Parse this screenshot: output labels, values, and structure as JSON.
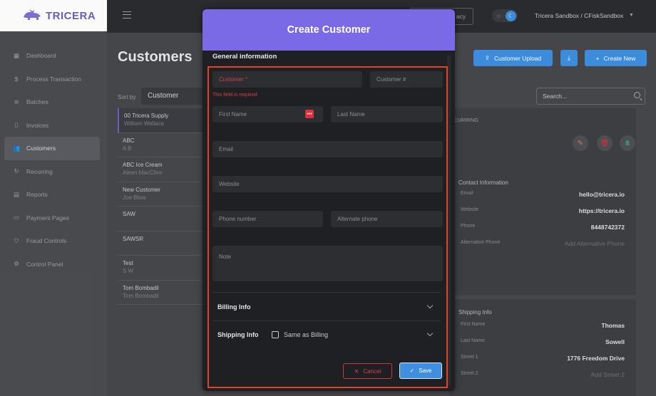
{
  "brand": {
    "logo_text": "TRICERA"
  },
  "sidebar": {
    "items": [
      {
        "label": "Dashboard",
        "icon": "grid-icon"
      },
      {
        "label": "Process Transaction",
        "icon": "dollar-circle-icon"
      },
      {
        "label": "Batches",
        "icon": "stack-icon"
      },
      {
        "label": "Invoices",
        "icon": "document-icon"
      },
      {
        "label": "Customers",
        "icon": "users-icon",
        "active": true
      },
      {
        "label": "Recurring",
        "icon": "refresh-icon"
      },
      {
        "label": "Reports",
        "icon": "report-icon"
      },
      {
        "label": "Payment Pages",
        "icon": "page-icon"
      },
      {
        "label": "Fraud Controls",
        "icon": "shield-icon"
      },
      {
        "label": "Control Panel",
        "icon": "gear-icon"
      }
    ]
  },
  "topbar": {
    "privacy_label": "acy",
    "account_label": "Tricera Sandbox / CFiskSandbox"
  },
  "page": {
    "title": "Customers",
    "upload_label": "Customer Upload",
    "create_label": "Create New",
    "sort_by_label": "Sort by",
    "sort_value": "Customer",
    "search_placeholder": "Search..."
  },
  "customers": [
    {
      "name": "00 Tricera Supply",
      "sub": "William Wallace"
    },
    {
      "name": "ABC",
      "sub": "A B"
    },
    {
      "name": "ABC Ice Cream",
      "sub": "Aleen MacClive"
    },
    {
      "name": "New Customer",
      "sub": "Joe Blow"
    },
    {
      "name": "SAW",
      "sub": ""
    },
    {
      "name": "SAWSR",
      "sub": ""
    },
    {
      "name": "Test",
      "sub": "S W"
    },
    {
      "name": "Tom Bombadil",
      "sub": "Tom Bombadil"
    }
  ],
  "detail": {
    "recurring_label": "CURRING",
    "contact_title": "Contact Information",
    "contact": [
      {
        "key": "Email",
        "value": "hello@tricera.io",
        "placeholder": false
      },
      {
        "key": "Website",
        "value": "https://tricera.io",
        "placeholder": false
      },
      {
        "key": "Phone",
        "value": "8448742372",
        "placeholder": false
      },
      {
        "key": "Alternative Phone",
        "value": "Add Alternative Phone",
        "placeholder": true
      }
    ],
    "shipping_title": "Shipping Info",
    "shipping": [
      {
        "key": "First Name",
        "value": "Thomas",
        "placeholder": false
      },
      {
        "key": "Last Name",
        "value": "Sowell",
        "placeholder": false
      },
      {
        "key": "Street 1",
        "value": "1776 Freedom Drive",
        "placeholder": false
      },
      {
        "key": "Street 2",
        "value": "Add Street 2",
        "placeholder": true
      }
    ]
  },
  "modal": {
    "title": "Create Customer",
    "section_label": "General information",
    "fields": {
      "customer": "Customer *",
      "customer_num": "Customer #",
      "first_name": "First Name",
      "last_name": "Last Name",
      "email": "Email",
      "website": "Website",
      "phone": "Phone number",
      "alt_phone": "Alternate phone",
      "note": "Note"
    },
    "error_text": "This field is required",
    "billing_label": "Billing Info",
    "shipping_label": "Shipping Info",
    "same_as_billing_label": "Same as Billing",
    "cancel_label": "Cancel",
    "save_label": "Save"
  },
  "colors": {
    "accent": "#3f8fe0",
    "modal_header": "#7b6ae6",
    "highlight": "#e0432a",
    "error": "#d6414b"
  }
}
